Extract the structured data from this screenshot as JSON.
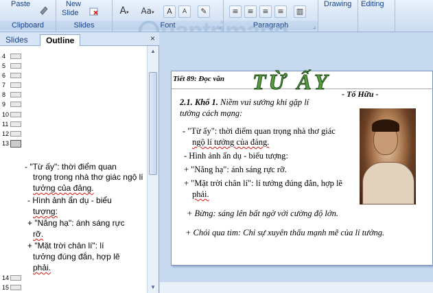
{
  "ribbon": {
    "clipboard": {
      "paste": "Paste",
      "label": "Clipboard"
    },
    "slides": {
      "new_slide": "New Slide",
      "new_slide_line1": "New",
      "new_slide_line2": "Slide",
      "label": "Slides"
    },
    "font": {
      "label": "Font"
    },
    "paragraph": {
      "label": "Paragraph"
    },
    "drawing": {
      "label": "Drawing"
    },
    "editing": {
      "label": "Editing"
    }
  },
  "left_pane": {
    "tabs": [
      {
        "label": "Slides"
      },
      {
        "label": "Outline",
        "active": true
      }
    ],
    "close": "×",
    "rows_top": [
      "4",
      "5",
      "6",
      "7",
      "8",
      "9",
      "10",
      "11",
      "12",
      "13"
    ],
    "rows_bottom": [
      "14",
      "15"
    ],
    "outline_lines": [
      "- \"Từ ấy\": thời điểm quan",
      "trọng trong nhà thơ giác ngộ lí",
      "tưởng của đảng.",
      "- Hình ảnh ẩn dụ - biểu",
      "tượng:",
      "+ \"Nắng hạ\": ánh sáng rực",
      "rỡ.",
      "+ \"Mặt trời chân lí\": lí",
      "tưởng đúng đắn, hợp lẽ",
      "phải."
    ]
  },
  "slide": {
    "lesson": "Tiết 89: Đọc văn",
    "title": "TỪ ẤY",
    "author": "- Tố Hữu -",
    "heading_bold": "2.1. Khổ 1.",
    "heading_rest": " Niềm vui sướng khi gặp lí",
    "heading_line2": "tưởng cách mạng:",
    "bullets": [
      "- \"Từ ấy\": thời điểm quan trọng nhà thơ giác",
      "ngộ lí tưởng của đảng.",
      "- Hình ảnh ẩn dụ - biểu tượng:",
      "+ \"Nắng hạ\": ánh sáng rực rỡ.",
      "+ \"Mặt trời chân lí\": lí tưởng đúng đắn, hợp lẽ",
      "phải."
    ],
    "note1": "+ Bừng: sáng lên bất ngờ với cường độ lớn.",
    "note2": "+ Chói qua tim: Chỉ sự xuyên thấu mạnh mẽ của lí tưởng."
  },
  "watermark": {
    "text": "uantrimang"
  }
}
